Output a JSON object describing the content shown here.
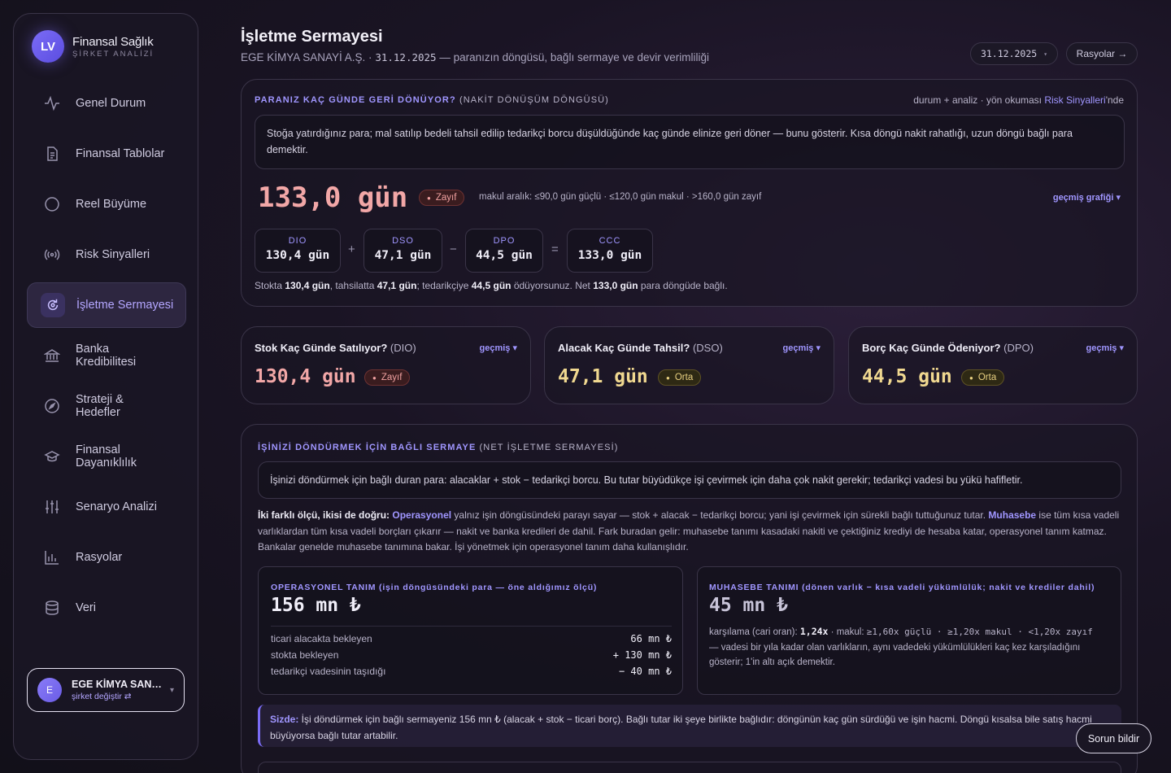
{
  "brand": {
    "logo": "LV",
    "title": "Finansal Sağlık",
    "subtitle": "ŞİRKET ANALİZİ"
  },
  "sidebar": {
    "items": [
      {
        "label": "Genel Durum",
        "icon": "pulse-icon"
      },
      {
        "label": "Finansal Tablolar",
        "icon": "document-icon"
      },
      {
        "label": "Reel Büyüme",
        "icon": "circle-icon"
      },
      {
        "label": "Risk Sinyalleri",
        "icon": "signal-icon"
      },
      {
        "label": "İşletme Sermayesi",
        "icon": "cycle-icon",
        "active": true
      },
      {
        "label": "Banka Kredibilitesi",
        "icon": "bank-icon"
      },
      {
        "label": "Strateji & Hedefler",
        "icon": "compass-icon"
      },
      {
        "label": "Finansal Dayanıklılık",
        "icon": "shield-icon"
      },
      {
        "label": "Senaryo Analizi",
        "icon": "sliders-icon"
      },
      {
        "label": "Rasyolar",
        "icon": "bar-chart-icon"
      },
      {
        "label": "Veri",
        "icon": "database-icon"
      }
    ],
    "company": {
      "avatar": "E",
      "name": "EGE KİMYA SAN…",
      "switch_label": "şirket değiştir ⇄"
    }
  },
  "header": {
    "title": "İşletme Sermayesi",
    "company": "EGE KİMYA SANAYİ A.Ş. · ",
    "date": "31.12.2025",
    "subtitle_rest": " — paranızın döngüsü, bağlı sermaye ve devir verimliliği",
    "date_pill": "31.12.2025",
    "ratios_button": "Rasyolar →"
  },
  "ccc_card": {
    "label": "PARANIZ KAÇ GÜNDE GERİ DÖNÜYOR?",
    "label_sub": "(NAKİT DÖNÜŞÜM DÖNGÜSÜ)",
    "right_note": "durum + analiz · yön okuması ",
    "right_link": "Risk Sinyalleri",
    "right_suffix": "'nde",
    "description": "Stoğa yatırdığınız para; mal satılıp bedeli tahsil edilip tedarikçi borcu düşüldüğünde kaç günde elinize geri döner — bunu gösterir. Kısa döngü nakit rahatlığı, uzun döngü bağlı para demektir.",
    "value": "133,0 gün",
    "status": "Zayıf",
    "range_text": "makul aralık: ≤90,0 gün güçlü · ≤120,0 gün makul · >160,0 gün zayıf",
    "history_link": "geçmiş grafiği ▾",
    "chips": [
      {
        "label": "DIO",
        "value": "130,4 gün"
      },
      {
        "label": "DSO",
        "value": "47,1 gün"
      },
      {
        "label": "DPO",
        "value": "44,5 gün"
      },
      {
        "label": "CCC",
        "value": "133,0 gün"
      }
    ],
    "ops": [
      "+",
      "−",
      "="
    ],
    "summary": {
      "p1": "Stokta ",
      "v1": "130,4 gün",
      "p2": ", tahsilatta ",
      "v2": "47,1 gün",
      "p3": "; tedarikçiye ",
      "v3": "44,5 gün",
      "p4": " ödüyorsunuz. Net ",
      "v4": "133,0 gün",
      "p5": " para döngüde bağlı."
    }
  },
  "mini_cards": [
    {
      "title": "Stok Kaç Günde Satılıyor?",
      "abbr": "(DIO)",
      "link": "geçmiş ▾",
      "value": "130,4 gün",
      "status": "Zayıf",
      "tone": "red"
    },
    {
      "title": "Alacak Kaç Günde Tahsil?",
      "abbr": "(DSO)",
      "link": "geçmiş ▾",
      "value": "47,1 gün",
      "status": "Orta",
      "tone": "yellow"
    },
    {
      "title": "Borç Kaç Günde Ödeniyor?",
      "abbr": "(DPO)",
      "link": "geçmiş ▾",
      "value": "44,5 gün",
      "status": "Orta",
      "tone": "yellow"
    }
  ],
  "nwc_card": {
    "label": "İŞİNİZİ DÖNDÜRMEK İÇİN BAĞLI SERMAYE",
    "label_sub": "(NET İŞLETME SERMAYESİ)",
    "description": "İşinizi döndürmek için bağlı duran para: alacaklar + stok − tedarikçi borcu. Bu tutar büyüdükçe işi çevirmek için daha çok nakit gerekir; tedarikçi vadesi bu yükü hafifletir.",
    "explain": {
      "lead": "İki farklı ölçü, ikisi de doğru: ",
      "op_word": "Operasyonel",
      "mid1": " yalnız işin döngüsündeki parayı sayar — stok + alacak − tedarikçi borcu; yani işi çevirmek için sürekli bağlı tuttuğunuz tutar. ",
      "acc_word": "Muhasebe",
      "mid2": " ise tüm kısa vadeli varlıklardan tüm kısa vadeli borçları çıkarır — nakit ve banka kredileri de dahil. Fark buradan gelir: muhasebe tanımı kasadaki nakiti ve çektiğiniz krediyi de hesaba katar, operasyonel tanım katmaz. Bankalar genelde muhasebe tanımına bakar. İşi yönetmek için operasyonel tanım daha kullanışlıdır."
    },
    "operational": {
      "label": "OPERASYONEL TANIM (işin döngüsündeki para — öne aldığımız ölçü)",
      "value": "156 mn ₺",
      "rows": [
        {
          "label": "ticari alacakta bekleyen",
          "value": "66 mn ₺"
        },
        {
          "label": "stokta bekleyen",
          "value": "+ 130 mn ₺"
        },
        {
          "label": "tedarikçi vadesinin taşıdığı",
          "value": "− 40 mn ₺"
        }
      ]
    },
    "accounting": {
      "label": "MUHASEBE TANIMI (dönen varlık − kısa vadeli yükümlülük; nakit ve krediler dahil)",
      "value": "45 mn ₺",
      "coverage_prefix": "karşılama (cari oran): ",
      "coverage_value": "1,24x",
      "coverage_mid": " · makul: ",
      "coverage_scale": "≥1,60x güçlü · ≥1,20x makul · <1,20x zayıf",
      "coverage_note": "— vadesi bir yıla kadar olan varlıkların, aynı vadedeki yükümlülükleri kaç kez karşıladığını gösterir; 1'in altı açık demektir."
    },
    "insight": {
      "lead": "Sizde:",
      "text": " İşi döndürmek için bağlı sermayeniz 156 mn ₺ (alacak + stok − ticari borç). Bağlı tutar iki şeye birlikte bağlıdır: döngünün kaç gün sürdüğü ve işin hacmi. Döngü kısalsa bile satış hacmi büyüyorsa bağlı tutar artabilir."
    }
  },
  "fab": {
    "label": "Sorun bildir"
  },
  "colors": {
    "accent": "#a096ff",
    "weak": "#f0a0a0",
    "medium": "#e8d080",
    "weak_value": "#f2a7a7",
    "medium_value": "#f0d890"
  }
}
